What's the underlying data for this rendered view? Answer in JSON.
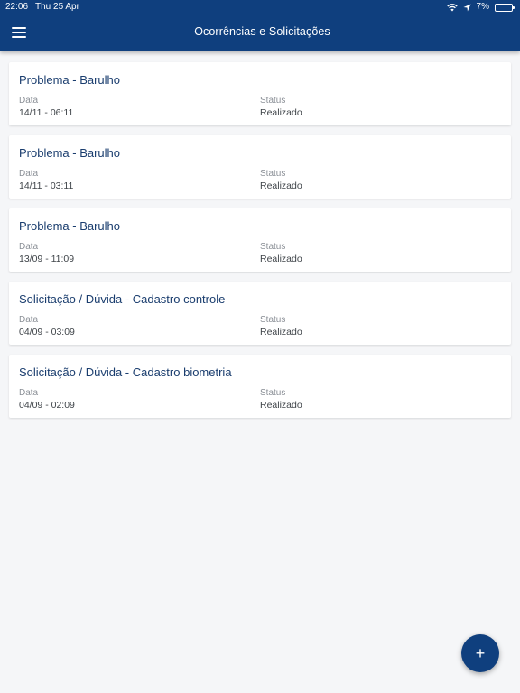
{
  "status_bar": {
    "time": "22:06",
    "date": "Thu 25 Apr",
    "battery_percent": "7%",
    "battery_level": 0.07,
    "battery_color": "#e53935"
  },
  "header": {
    "title": "Ocorrências e Solicitações",
    "background": "#0f3f7e",
    "menu_icon": "hamburger-menu-icon"
  },
  "labels": {
    "data": "Data",
    "status": "Status"
  },
  "items": [
    {
      "title": "Problema - Barulho",
      "date": "14/11 - 06:11",
      "status": "Realizado"
    },
    {
      "title": "Problema - Barulho",
      "date": "14/11 - 03:11",
      "status": "Realizado"
    },
    {
      "title": "Problema - Barulho",
      "date": "13/09 - 11:09",
      "status": "Realizado"
    },
    {
      "title": "Solicitação / Dúvida - Cadastro controle",
      "date": "04/09 - 03:09",
      "status": "Realizado"
    },
    {
      "title": "Solicitação / Dúvida - Cadastro biometria",
      "date": "04/09 - 02:09",
      "status": "Realizado"
    }
  ],
  "fab": {
    "label": "+",
    "icon": "plus-icon"
  }
}
